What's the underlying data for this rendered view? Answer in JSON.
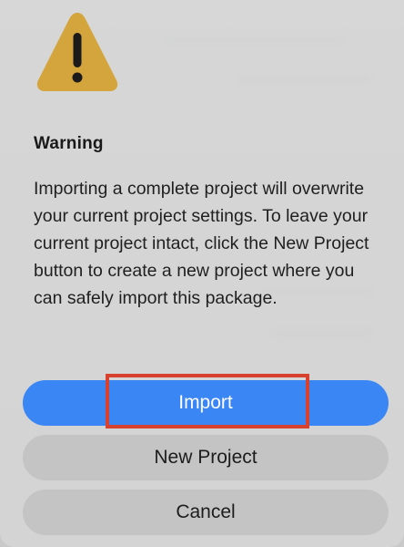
{
  "dialog": {
    "icon": "warning-triangle-icon",
    "title": "Warning",
    "message": "Importing a complete project will overwrite your current project settings. To leave your current project intact, click the New Project button to create a new project where you can safely import this package.",
    "buttons": {
      "import_label": "Import",
      "new_project_label": "New Project",
      "cancel_label": "Cancel"
    }
  },
  "colors": {
    "accent": "#3a86f5",
    "warning_icon": "#d4a53c",
    "highlight_border": "#d9412f"
  }
}
